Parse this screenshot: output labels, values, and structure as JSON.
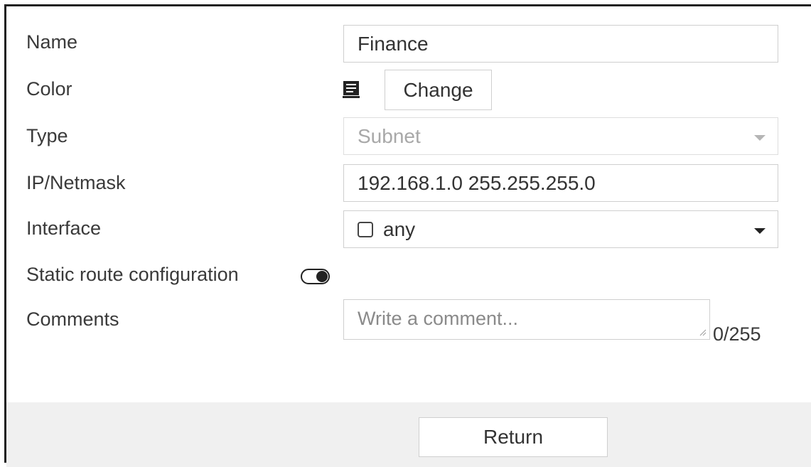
{
  "form": {
    "name": {
      "label": "Name",
      "value": "Finance"
    },
    "color": {
      "label": "Color",
      "icon": "color-swatch-icon",
      "button_label": "Change"
    },
    "type": {
      "label": "Type",
      "value": "Subnet"
    },
    "ip_netmask": {
      "label": "IP/Netmask",
      "value": "192.168.1.0 255.255.255.0"
    },
    "interface": {
      "label": "Interface",
      "value": "any"
    },
    "static_route": {
      "label": "Static route configuration",
      "enabled": false
    },
    "comments": {
      "label": "Comments",
      "placeholder": "Write a comment...",
      "counter": "0/255"
    }
  },
  "footer": {
    "return_label": "Return"
  }
}
